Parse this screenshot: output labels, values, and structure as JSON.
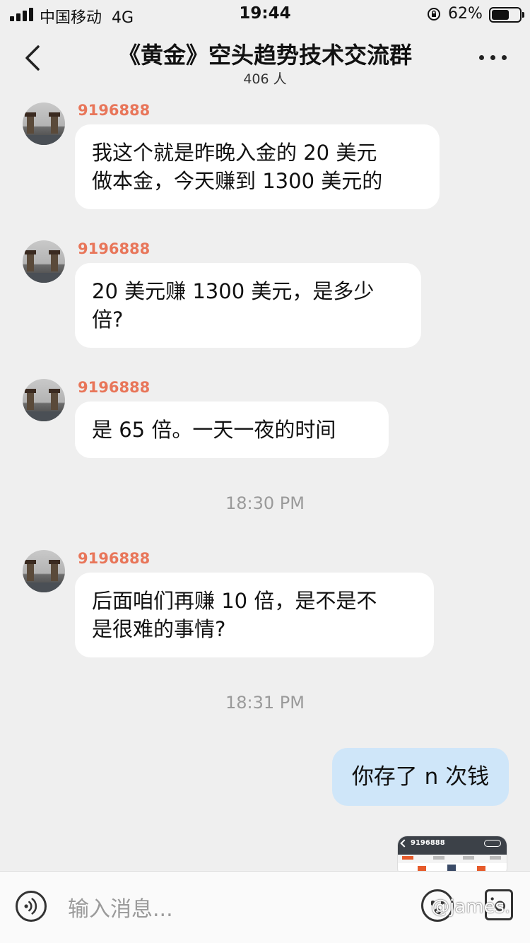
{
  "status_bar": {
    "carrier": "中国移动",
    "network": "4G",
    "time": "19:44",
    "battery_percent": "62%",
    "battery_level": 0.62,
    "icons": [
      "signal-icon",
      "orientation-lock-icon",
      "battery-icon"
    ]
  },
  "header": {
    "title": "《黄金》空头趋势技术交流群",
    "member_count": "406 人",
    "icons": [
      "back-arrow-icon",
      "more-icon"
    ]
  },
  "messages": [
    {
      "sender": "9196888",
      "lines": [
        "我这个就是昨晚入金的 20 美元",
        "做本金，今天赚到 1300 美元的"
      ]
    },
    {
      "sender": "9196888",
      "lines": [
        "20 美元赚 1300 美元，是多少",
        "倍?"
      ]
    },
    {
      "sender": "9196888",
      "lines": [
        "是 65 倍。一天一夜的时间"
      ]
    },
    {
      "sender": "9196888",
      "lines": [
        "后面咱们再赚 10 倍，是不是不",
        "是很难的事情?"
      ]
    }
  ],
  "timestamps": [
    "18:30 PM",
    "18:31 PM"
  ],
  "outgoing": {
    "text": "你存了 n 次钱"
  },
  "image_message": {
    "sender_id": "9196888"
  },
  "input_bar": {
    "placeholder": "输入消息...",
    "icons": [
      "voice-icon",
      "emoji-icon",
      "image-icon"
    ]
  },
  "watermark": "@james.",
  "colors": {
    "background": "#efefef",
    "sender_name": "#e8765a",
    "incoming_bubble": "#ffffff",
    "outgoing_bubble": "#cfe6f9",
    "timestamp": "#9a9a9a"
  }
}
